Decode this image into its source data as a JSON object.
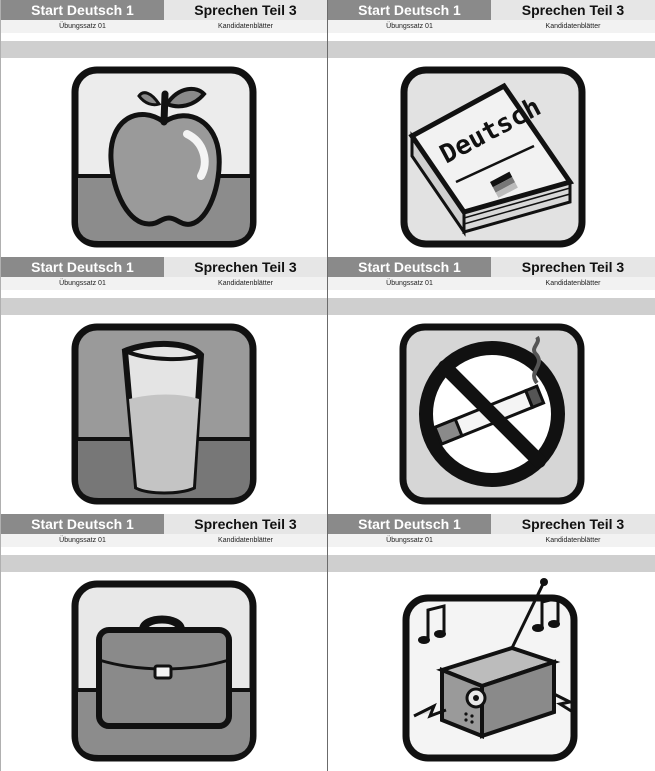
{
  "cards": [
    {
      "brand": "Start Deutsch 1",
      "part": "Sprechen Teil 3",
      "set": "Übungssatz 01",
      "sheet": "Kandidatenblätter",
      "icon": "apple-icon"
    },
    {
      "brand": "Start Deutsch 1",
      "part": "Sprechen Teil 3",
      "set": "Übungssatz 01",
      "sheet": "Kandidatenblätter",
      "icon": "book-icon",
      "book_title": "Deutsch"
    },
    {
      "brand": "Start Deutsch 1",
      "part": "Sprechen Teil 3",
      "set": "Übungssatz 01",
      "sheet": "Kandidatenblätter",
      "icon": "glass-icon"
    },
    {
      "brand": "Start Deutsch 1",
      "part": "Sprechen Teil 3",
      "set": "Übungssatz 01",
      "sheet": "Kandidatenblätter",
      "icon": "no-smoking-icon"
    },
    {
      "brand": "Start Deutsch 1",
      "part": "Sprechen Teil 3",
      "set": "Übungssatz 01",
      "sheet": "Kandidatenblätter",
      "icon": "briefcase-icon"
    },
    {
      "brand": "Start Deutsch 1",
      "part": "Sprechen Teil 3",
      "set": "Übungssatz 01",
      "sheet": "Kandidatenblätter",
      "icon": "radio-icon"
    }
  ],
  "colors": {
    "header_dark": "#8a8a8a",
    "header_light": "#e6e6e6",
    "band": "#cfcfcf",
    "ink": "#111111"
  }
}
